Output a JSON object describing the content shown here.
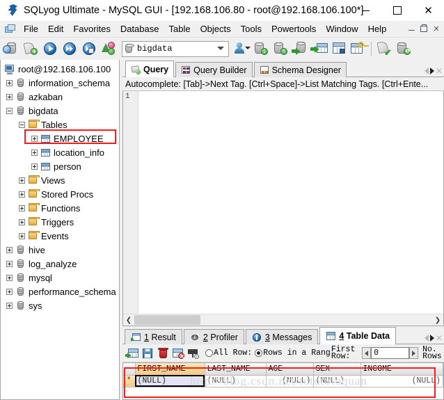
{
  "window": {
    "title": "SQLyog Ultimate - MySQL GUI - [192.168.106.80 - root@192.168.106.100*]",
    "app_icon": "sqlyog-dolphin-icon",
    "controls": {
      "minimize": "–",
      "maximize": "□",
      "close": "✕"
    }
  },
  "menubar": {
    "items": [
      {
        "label": "File"
      },
      {
        "label": "Edit"
      },
      {
        "label": "Favorites"
      },
      {
        "label": "Database"
      },
      {
        "label": "Table"
      },
      {
        "label": "Objects"
      },
      {
        "label": "Tools"
      },
      {
        "label": "Powertools"
      },
      {
        "label": "Window"
      },
      {
        "label": "Help"
      }
    ],
    "mdi_controls": {
      "minimize": "_",
      "restore": "❐",
      "close": "✕"
    }
  },
  "toolbar": {
    "db_selector": {
      "value": "bigdata",
      "icon": "database-icon"
    },
    "buttons": [
      {
        "name": "new-connection",
        "icon": "connect-db-icon"
      },
      {
        "name": "new-query-tab",
        "icon": "new-query-icon"
      },
      {
        "name": "execute-query",
        "icon": "execute-icon"
      },
      {
        "name": "execute-all-queries",
        "icon": "execute-all-icon"
      },
      {
        "name": "execute-current",
        "icon": "execute-current-icon"
      },
      {
        "name": "stop-query",
        "icon": "stop-icon"
      },
      {
        "name": "user-manager",
        "icon": "user-icon"
      },
      {
        "name": "import-data",
        "icon": "db-import-icon"
      },
      {
        "name": "export-data",
        "icon": "db-export-icon"
      },
      {
        "name": "backup-database",
        "icon": "db-backup-icon"
      },
      {
        "name": "restore-database",
        "icon": "db-restore-icon"
      },
      {
        "name": "table-diagnostics",
        "icon": "table-tools-icon"
      },
      {
        "name": "manage-indexes",
        "icon": "table-key-icon"
      },
      {
        "name": "object-browser-refresh",
        "icon": "scroll-check-icon"
      },
      {
        "name": "sync-database",
        "icon": "db-sync-icon"
      }
    ]
  },
  "tree": {
    "root": {
      "label": "root@192.168.106.100",
      "icon": "server-icon",
      "level": 0,
      "expander": "none"
    },
    "nodes": [
      {
        "label": "information_schema",
        "icon": "database-icon",
        "level": 1,
        "expander": "plus"
      },
      {
        "label": "azkaban",
        "icon": "database-icon",
        "level": 1,
        "expander": "plus"
      },
      {
        "label": "bigdata",
        "icon": "database-icon",
        "level": 1,
        "expander": "minus"
      },
      {
        "label": "Tables",
        "icon": "folder-icon",
        "level": 2,
        "expander": "minus"
      },
      {
        "label": "EMPLOYEE",
        "icon": "table-icon",
        "level": 3,
        "expander": "plus",
        "highlighted": true
      },
      {
        "label": "location_info",
        "icon": "table-icon",
        "level": 3,
        "expander": "plus"
      },
      {
        "label": "person",
        "icon": "table-icon",
        "level": 3,
        "expander": "plus"
      },
      {
        "label": "Views",
        "icon": "folder-icon",
        "level": 2,
        "expander": "plus"
      },
      {
        "label": "Stored Procs",
        "icon": "folder-icon",
        "level": 2,
        "expander": "plus"
      },
      {
        "label": "Functions",
        "icon": "folder-icon",
        "level": 2,
        "expander": "plus"
      },
      {
        "label": "Triggers",
        "icon": "folder-icon",
        "level": 2,
        "expander": "plus"
      },
      {
        "label": "Events",
        "icon": "folder-icon",
        "level": 2,
        "expander": "plus"
      },
      {
        "label": "hive",
        "icon": "database-icon",
        "level": 1,
        "expander": "plus"
      },
      {
        "label": "log_analyze",
        "icon": "database-icon",
        "level": 1,
        "expander": "plus"
      },
      {
        "label": "mysql",
        "icon": "database-icon",
        "level": 1,
        "expander": "plus"
      },
      {
        "label": "performance_schema",
        "icon": "database-icon",
        "level": 1,
        "expander": "plus"
      },
      {
        "label": "sys",
        "icon": "database-icon",
        "level": 1,
        "expander": "plus"
      }
    ]
  },
  "editor": {
    "tabs": [
      {
        "label": "Query",
        "icon": "query-icon",
        "active": true
      },
      {
        "label": "Query Builder",
        "icon": "query-builder-icon",
        "active": false
      },
      {
        "label": "Schema Designer",
        "icon": "schema-designer-icon",
        "active": false
      }
    ],
    "autocomplete_hint": "Autocomplete: [Tab]->Next Tag. [Ctrl+Space]->List Matching Tags. [Ctrl+Ente...",
    "line_number": "1",
    "content": "",
    "scroll_left_arrow": "❮",
    "scroll_right_arrow": "❯"
  },
  "results": {
    "tabs": [
      {
        "num": "1",
        "label": "Result",
        "icon": "result-grid-icon",
        "active": false
      },
      {
        "num": "2",
        "label": "Profiler",
        "icon": "profiler-icon",
        "active": false
      },
      {
        "num": "3",
        "label": "Messages",
        "icon": "messages-info-icon",
        "active": false
      },
      {
        "num": "4",
        "label": "Table Data",
        "icon": "table-data-icon",
        "active": true
      }
    ],
    "toolbar_buttons": [
      {
        "name": "insert-row",
        "icon": "add-row-icon"
      },
      {
        "name": "save-changes",
        "icon": "save-floppy-icon"
      },
      {
        "name": "delete-row",
        "icon": "delete-trash-icon"
      },
      {
        "name": "refresh-data",
        "icon": "refresh-grid-icon"
      },
      {
        "name": "filter-data",
        "icon": "funnel-filter-icon"
      }
    ],
    "row_mode": {
      "all_rows_label": "All Row:",
      "range_label": "Rows in a Rang",
      "selected": "range"
    },
    "first_row_label": "First Row:",
    "first_row_value": "0",
    "no_rows_label": "No. Rows",
    "spin_prev": "◀",
    "spin_next": "▶"
  },
  "grid": {
    "columns": [
      "FIRST_NAME",
      "LAST_NAME",
      "AGE",
      "SEX",
      "INCOME"
    ],
    "selected_column": "FIRST_NAME",
    "rows": [
      {
        "marker": "*",
        "cells": [
          "(NULL)",
          "(NULL)",
          "(NULL)",
          "(NULL)",
          "(NULL)"
        ]
      }
    ],
    "watermark": "http://blog.csdn.net/totototoquan"
  },
  "annotations": {
    "highlight_color": "#ff1a1a",
    "boxes": [
      "employee-tree-node",
      "table-data-grid"
    ]
  }
}
